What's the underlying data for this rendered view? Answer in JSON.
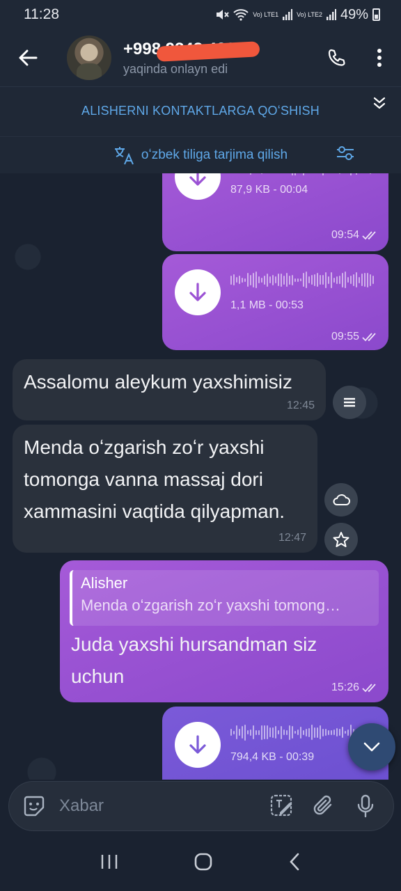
{
  "status_bar": {
    "time": "11:28",
    "sim1": "Vo) LTE1",
    "sim2": "Vo) LTE2",
    "battery": "49%"
  },
  "header": {
    "contact_name": "+998 9348 4222",
    "contact_status": "yaqinda onlayn edi"
  },
  "add_contact_bar": {
    "label": "ALISHERNI KONTAKTLARGA QOʻSHISH"
  },
  "translate_bar": {
    "label": "oʻzbek tiliga tarjima qilish"
  },
  "messages": [
    {
      "type": "voice",
      "direction": "out",
      "meta": "87,9 KB - 00:04",
      "time": "09:54",
      "read": true
    },
    {
      "type": "voice",
      "direction": "out",
      "meta": "1,1 MB - 00:53",
      "time": "09:55",
      "read": true
    },
    {
      "type": "text",
      "direction": "in",
      "text": "Assalomu aleykum yaxshimisiz",
      "time": "12:45"
    },
    {
      "type": "text",
      "direction": "in",
      "lines": [
        "Menda oʻzgarish zoʻr yaxshi",
        "tomonga vanna massaj dori",
        "xammasini vaqtida qilyapman."
      ],
      "time": "12:47"
    },
    {
      "type": "reply",
      "direction": "out",
      "reply_name": "Alisher",
      "reply_text": "Menda oʻzgarish zoʻr yaxshi tomong…",
      "lines": [
        "Juda yaxshi  hursandman siz",
        "uchun"
      ],
      "time": "15:26",
      "read": true
    },
    {
      "type": "voice",
      "direction": "out",
      "meta": "794,4 KB - 00:39"
    }
  ],
  "input": {
    "placeholder": "Xabar"
  },
  "colors": {
    "outgoing_bubble": "#9b52d4",
    "incoming_bubble": "#2a313c",
    "accent_link": "#5fa8e8",
    "background": "#1a2230"
  }
}
